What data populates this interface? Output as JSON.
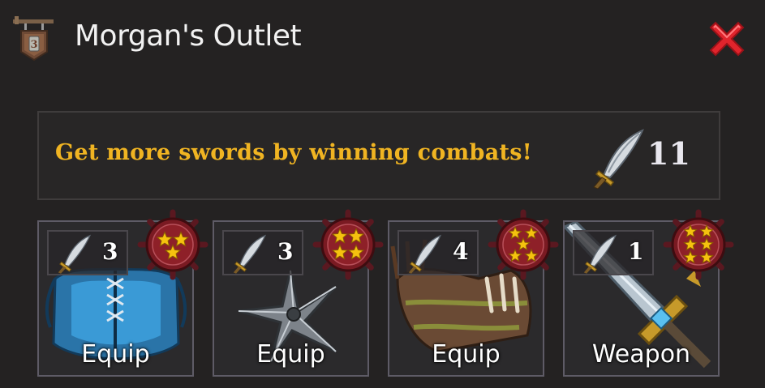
{
  "window": {
    "title": "Morgan's Outlet"
  },
  "banner": {
    "message": "Get more swords by winning combats!",
    "sword_count": "11"
  },
  "items": [
    {
      "label": "Equip",
      "cost": "3",
      "stars": 3,
      "art": "blue-armor"
    },
    {
      "label": "Equip",
      "cost": "3",
      "stars": 4,
      "art": "shuriken"
    },
    {
      "label": "Equip",
      "cost": "4",
      "stars": 5,
      "art": "claw-gauntlet"
    },
    {
      "label": "Weapon",
      "cost": "1",
      "stars": 6,
      "art": "broadsword"
    }
  ],
  "icons": {
    "header": "shop-sign-icon",
    "close": "close-x-icon",
    "currency": "sword-currency-icon",
    "rank": "star-rank-wheel-icon"
  },
  "colors": {
    "accent": "#f0b422",
    "close": "#e0242c",
    "badge": "#7a1a22",
    "star": "#f5c20f"
  }
}
